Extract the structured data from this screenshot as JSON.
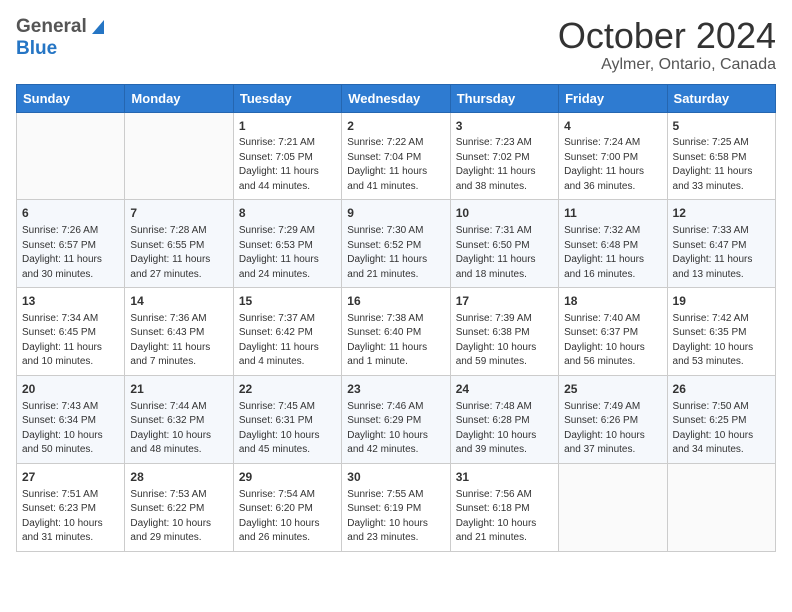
{
  "header": {
    "logo_general": "General",
    "logo_blue": "Blue",
    "month": "October 2024",
    "location": "Aylmer, Ontario, Canada"
  },
  "days_of_week": [
    "Sunday",
    "Monday",
    "Tuesday",
    "Wednesday",
    "Thursday",
    "Friday",
    "Saturday"
  ],
  "weeks": [
    [
      {
        "day": "",
        "info": ""
      },
      {
        "day": "",
        "info": ""
      },
      {
        "day": "1",
        "info": "Sunrise: 7:21 AM\nSunset: 7:05 PM\nDaylight: 11 hours and 44 minutes."
      },
      {
        "day": "2",
        "info": "Sunrise: 7:22 AM\nSunset: 7:04 PM\nDaylight: 11 hours and 41 minutes."
      },
      {
        "day": "3",
        "info": "Sunrise: 7:23 AM\nSunset: 7:02 PM\nDaylight: 11 hours and 38 minutes."
      },
      {
        "day": "4",
        "info": "Sunrise: 7:24 AM\nSunset: 7:00 PM\nDaylight: 11 hours and 36 minutes."
      },
      {
        "day": "5",
        "info": "Sunrise: 7:25 AM\nSunset: 6:58 PM\nDaylight: 11 hours and 33 minutes."
      }
    ],
    [
      {
        "day": "6",
        "info": "Sunrise: 7:26 AM\nSunset: 6:57 PM\nDaylight: 11 hours and 30 minutes."
      },
      {
        "day": "7",
        "info": "Sunrise: 7:28 AM\nSunset: 6:55 PM\nDaylight: 11 hours and 27 minutes."
      },
      {
        "day": "8",
        "info": "Sunrise: 7:29 AM\nSunset: 6:53 PM\nDaylight: 11 hours and 24 minutes."
      },
      {
        "day": "9",
        "info": "Sunrise: 7:30 AM\nSunset: 6:52 PM\nDaylight: 11 hours and 21 minutes."
      },
      {
        "day": "10",
        "info": "Sunrise: 7:31 AM\nSunset: 6:50 PM\nDaylight: 11 hours and 18 minutes."
      },
      {
        "day": "11",
        "info": "Sunrise: 7:32 AM\nSunset: 6:48 PM\nDaylight: 11 hours and 16 minutes."
      },
      {
        "day": "12",
        "info": "Sunrise: 7:33 AM\nSunset: 6:47 PM\nDaylight: 11 hours and 13 minutes."
      }
    ],
    [
      {
        "day": "13",
        "info": "Sunrise: 7:34 AM\nSunset: 6:45 PM\nDaylight: 11 hours and 10 minutes."
      },
      {
        "day": "14",
        "info": "Sunrise: 7:36 AM\nSunset: 6:43 PM\nDaylight: 11 hours and 7 minutes."
      },
      {
        "day": "15",
        "info": "Sunrise: 7:37 AM\nSunset: 6:42 PM\nDaylight: 11 hours and 4 minutes."
      },
      {
        "day": "16",
        "info": "Sunrise: 7:38 AM\nSunset: 6:40 PM\nDaylight: 11 hours and 1 minute."
      },
      {
        "day": "17",
        "info": "Sunrise: 7:39 AM\nSunset: 6:38 PM\nDaylight: 10 hours and 59 minutes."
      },
      {
        "day": "18",
        "info": "Sunrise: 7:40 AM\nSunset: 6:37 PM\nDaylight: 10 hours and 56 minutes."
      },
      {
        "day": "19",
        "info": "Sunrise: 7:42 AM\nSunset: 6:35 PM\nDaylight: 10 hours and 53 minutes."
      }
    ],
    [
      {
        "day": "20",
        "info": "Sunrise: 7:43 AM\nSunset: 6:34 PM\nDaylight: 10 hours and 50 minutes."
      },
      {
        "day": "21",
        "info": "Sunrise: 7:44 AM\nSunset: 6:32 PM\nDaylight: 10 hours and 48 minutes."
      },
      {
        "day": "22",
        "info": "Sunrise: 7:45 AM\nSunset: 6:31 PM\nDaylight: 10 hours and 45 minutes."
      },
      {
        "day": "23",
        "info": "Sunrise: 7:46 AM\nSunset: 6:29 PM\nDaylight: 10 hours and 42 minutes."
      },
      {
        "day": "24",
        "info": "Sunrise: 7:48 AM\nSunset: 6:28 PM\nDaylight: 10 hours and 39 minutes."
      },
      {
        "day": "25",
        "info": "Sunrise: 7:49 AM\nSunset: 6:26 PM\nDaylight: 10 hours and 37 minutes."
      },
      {
        "day": "26",
        "info": "Sunrise: 7:50 AM\nSunset: 6:25 PM\nDaylight: 10 hours and 34 minutes."
      }
    ],
    [
      {
        "day": "27",
        "info": "Sunrise: 7:51 AM\nSunset: 6:23 PM\nDaylight: 10 hours and 31 minutes."
      },
      {
        "day": "28",
        "info": "Sunrise: 7:53 AM\nSunset: 6:22 PM\nDaylight: 10 hours and 29 minutes."
      },
      {
        "day": "29",
        "info": "Sunrise: 7:54 AM\nSunset: 6:20 PM\nDaylight: 10 hours and 26 minutes."
      },
      {
        "day": "30",
        "info": "Sunrise: 7:55 AM\nSunset: 6:19 PM\nDaylight: 10 hours and 23 minutes."
      },
      {
        "day": "31",
        "info": "Sunrise: 7:56 AM\nSunset: 6:18 PM\nDaylight: 10 hours and 21 minutes."
      },
      {
        "day": "",
        "info": ""
      },
      {
        "day": "",
        "info": ""
      }
    ]
  ]
}
